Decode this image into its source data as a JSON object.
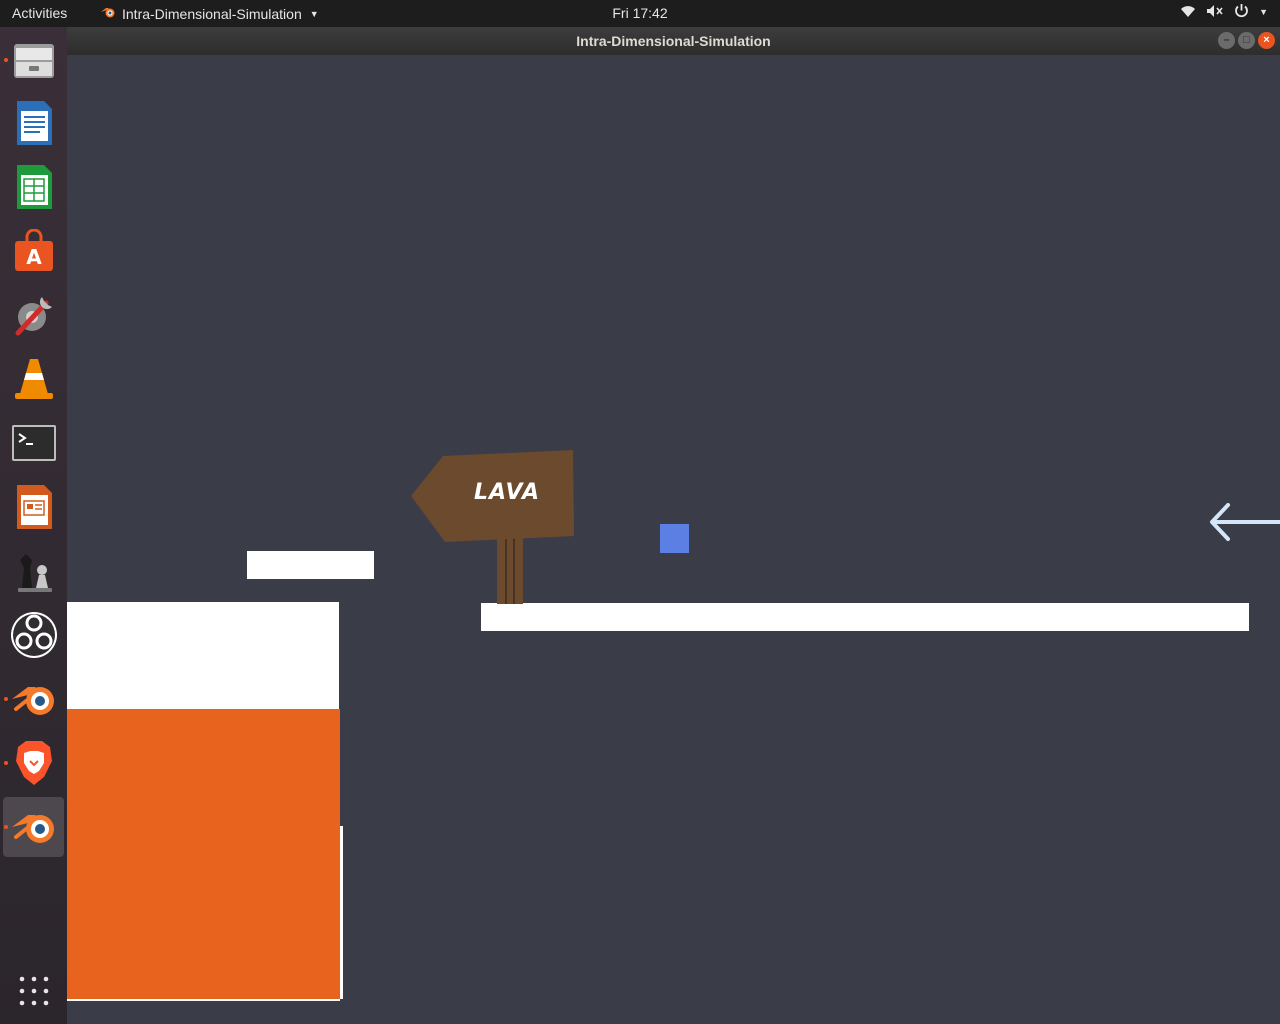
{
  "top_bar": {
    "activities": "Activities",
    "app_name": "Intra-Dimensional-Simulation",
    "clock": "Fri 17:42",
    "tray_icons": [
      "wifi-icon",
      "volume-muted-icon",
      "power-icon",
      "chevron-down-icon"
    ]
  },
  "dock": {
    "items": [
      {
        "name": "files",
        "icon": "file-cabinet-icon",
        "running": true,
        "active": false
      },
      {
        "name": "libreoffice-writer",
        "icon": "writer-icon",
        "running": false,
        "active": false
      },
      {
        "name": "libreoffice-calc",
        "icon": "calc-icon",
        "running": false,
        "active": false
      },
      {
        "name": "ubuntu-software",
        "icon": "software-bag-icon",
        "running": false,
        "active": false
      },
      {
        "name": "system-tools",
        "icon": "tools-gear-icon",
        "running": false,
        "active": false
      },
      {
        "name": "vlc",
        "icon": "traffic-cone-icon",
        "running": false,
        "active": false
      },
      {
        "name": "terminal",
        "icon": "terminal-icon",
        "running": false,
        "active": false
      },
      {
        "name": "libreoffice-impress",
        "icon": "impress-icon",
        "running": false,
        "active": false
      },
      {
        "name": "chess",
        "icon": "chess-pieces-icon",
        "running": false,
        "active": false
      },
      {
        "name": "obs-studio",
        "icon": "obs-icon",
        "running": false,
        "active": false
      },
      {
        "name": "blender",
        "icon": "blender-icon",
        "running": true,
        "active": false
      },
      {
        "name": "brave-browser",
        "icon": "brave-lion-icon",
        "running": true,
        "active": false
      },
      {
        "name": "blender-game",
        "icon": "blender-icon",
        "running": true,
        "active": true
      }
    ],
    "show_apps_icon": "grid-dots-icon"
  },
  "window": {
    "title": "Intra-Dimensional-Simulation",
    "controls": [
      "minimize-icon",
      "maximize-icon",
      "close-icon"
    ]
  },
  "game": {
    "sign_text": "LAVA",
    "colors": {
      "background": "#3a3c47",
      "platform": "#ffffff",
      "lava": "#e8631e",
      "player": "#5b7fe3",
      "sign": "#6b4a2e",
      "arrow": "#d6e6fa"
    },
    "arrow_icon": "left-arrow-icon"
  }
}
